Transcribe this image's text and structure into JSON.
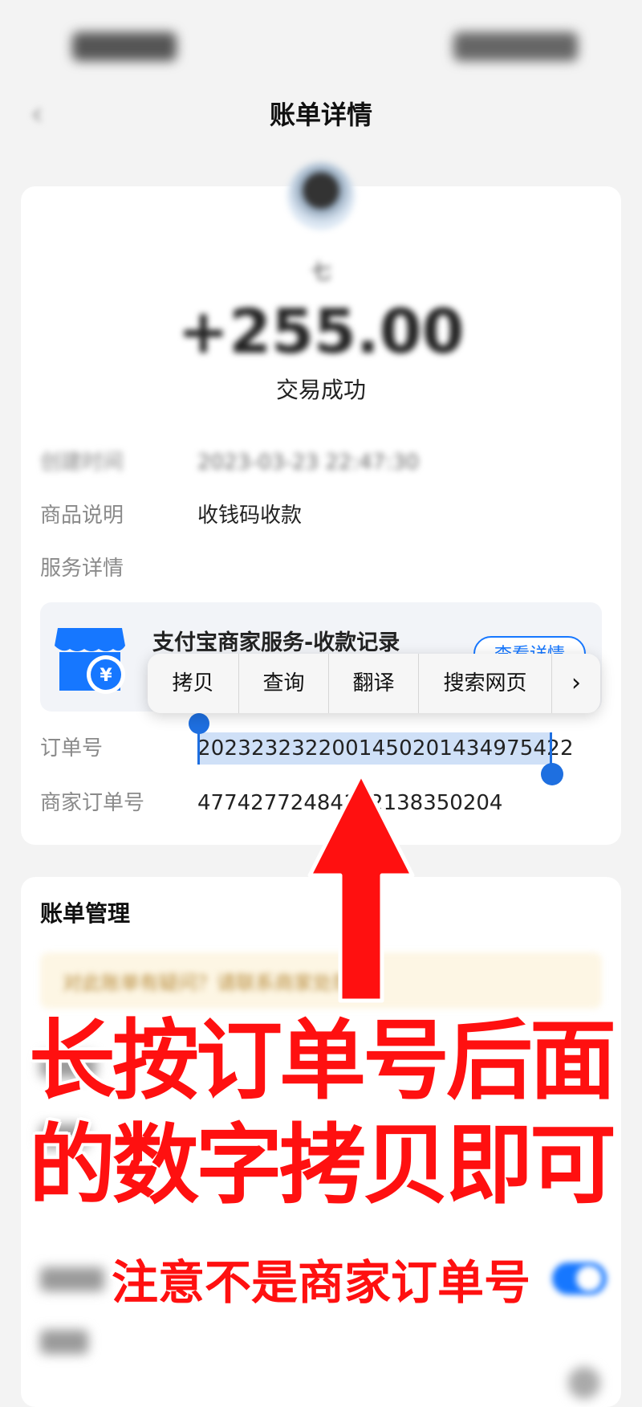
{
  "header": {
    "title": "账单详情",
    "back_icon": "chevron-left-icon"
  },
  "transaction": {
    "payer": "七",
    "amount": "+255.00",
    "status": "交易成功",
    "rows": {
      "time_label": "创建时间",
      "time_value": "2023-03-23 22:47:30",
      "goods_label": "商品说明",
      "goods_value": "收钱码收款",
      "service_label": "服务详情",
      "order_label": "订单号",
      "order_value": "2023232322001450201434975422",
      "merchant_order_label": "商家订单号",
      "merchant_order_value": "47742772484122138350204"
    }
  },
  "service": {
    "icon": "store-yuan-icon",
    "title": "支付宝商家服务-收款记录",
    "button": "查看详情"
  },
  "context_menu": {
    "items": [
      "拷贝",
      "查询",
      "翻译",
      "搜索网页"
    ],
    "more_icon": "chevron-right-icon"
  },
  "management": {
    "title": "账单管理",
    "notice": "对此账单有疑问？请联系商家处理"
  },
  "annotation": {
    "line1": "长按订单号后面",
    "line2": "的数字拷贝即可",
    "line3": "注意不是商家订单号"
  },
  "colors": {
    "accent": "#1677ff",
    "annotation": "#ff1010",
    "selection": "#cfe0f7"
  }
}
